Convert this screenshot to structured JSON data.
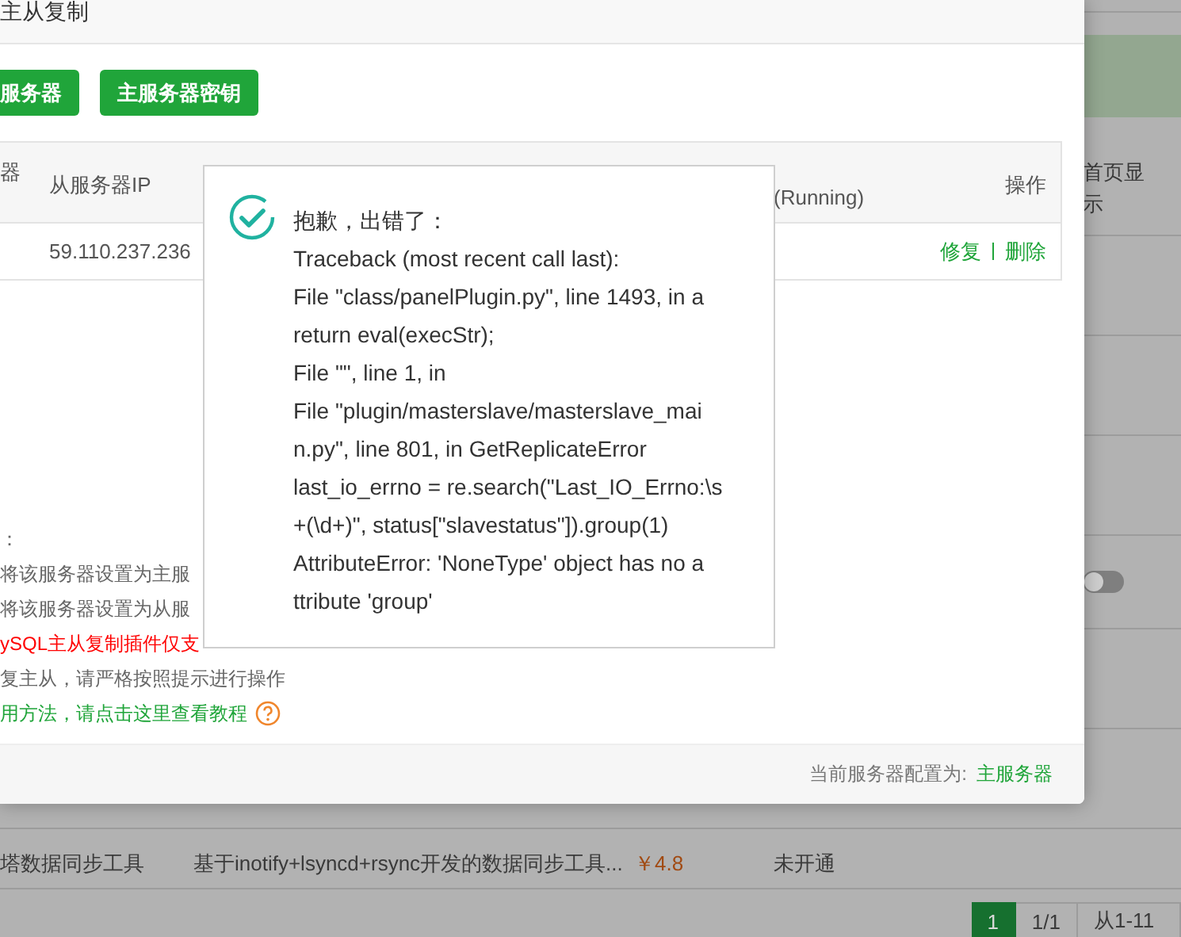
{
  "background_page": {
    "side_header": "首页显示",
    "side_toggle": {
      "on": false
    },
    "rows": [
      {
        "name": "塔数据同步工具",
        "description": "基于inotify+lsyncd+rsync开发的数据同步工具...",
        "price": "￥4.8",
        "status": "未开通"
      }
    ],
    "pagination": [
      {
        "label": "1",
        "selected": true
      },
      {
        "label": "1/1",
        "selected": false
      },
      {
        "label": "从1-11",
        "selected": false
      }
    ]
  },
  "modal": {
    "title": "主从复制",
    "buttons": [
      "服务器",
      "主服务器密钥"
    ],
    "table": {
      "columns": [
        "器",
        "从服务器IP",
        "(Running)",
        "操作"
      ],
      "rows": [
        {
          "ip": "59.110.237.236",
          "actions": [
            "修复",
            "删除"
          ]
        }
      ]
    },
    "notes": [
      {
        "text": "：",
        "kind": "plain"
      },
      {
        "text": "将该服务器设置为主服",
        "kind": "plain"
      },
      {
        "text": "将该服务器设置为从服",
        "kind": "plain"
      },
      {
        "text": "ySQL主从复制插件仅支",
        "kind": "warning"
      },
      {
        "text": "复主从，请严格按照提示进行操作",
        "kind": "plain"
      },
      {
        "text": "用方法，请点击这里查看教程",
        "kind": "link"
      }
    ],
    "footer": {
      "label": "当前服务器配置为:",
      "value": "主服务器"
    }
  },
  "dialog": {
    "heading": "抱歉，出错了：",
    "lines": [
      "Traceback (most recent call last):",
      "File \"class/panelPlugin.py\", line 1493, in a",
      "return eval(execStr);",
      "File \"\", line 1, in",
      "File \"plugin/masterslave/masterslave_mai",
      "n.py\", line 801, in GetReplicateError",
      "last_io_errno = re.search(\"Last_IO_Errno:\\s",
      "+(\\d+)\", status[\"slavestatus\"]).group(1)",
      "AttributeError: 'NoneType' object has no a",
      "ttribute 'group'"
    ]
  }
}
